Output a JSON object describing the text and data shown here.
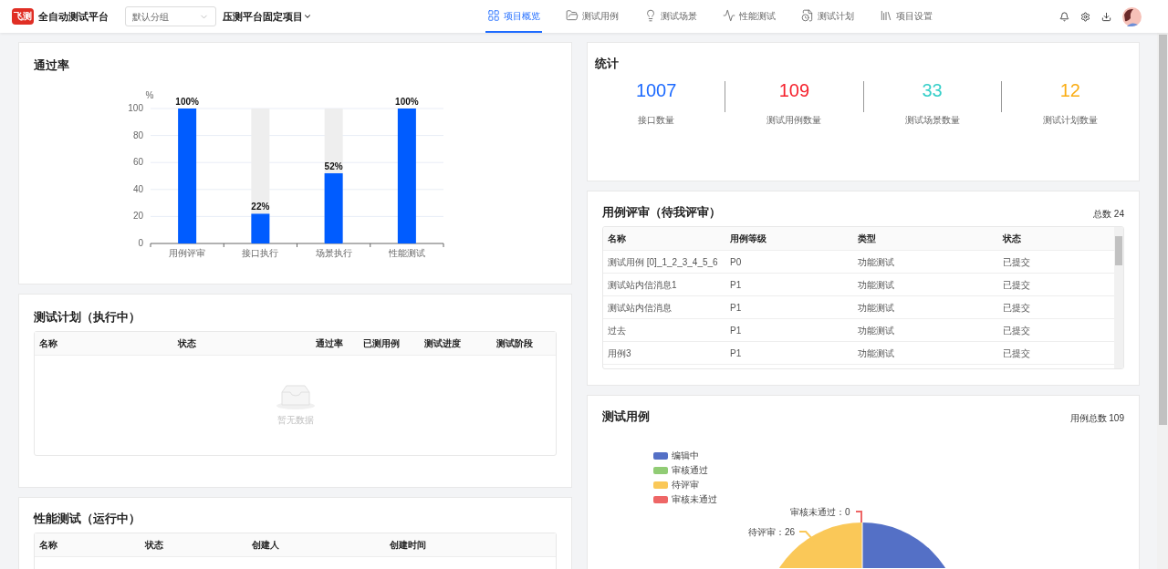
{
  "header": {
    "logo_text": "飞测",
    "app_name": "全自动测试平台",
    "group_select": {
      "value": "默认分组"
    },
    "project": "压测平台固定项目",
    "nav": [
      {
        "label": "项目概览",
        "selected": true
      },
      {
        "label": "测试用例",
        "selected": false
      },
      {
        "label": "测试场景",
        "selected": false
      },
      {
        "label": "性能测试",
        "selected": false
      },
      {
        "label": "测试计划",
        "selected": false
      },
      {
        "label": "项目设置",
        "selected": false
      }
    ]
  },
  "pass_rate": {
    "title": "通过率",
    "chart_data": {
      "type": "bar",
      "ylabel": "%",
      "categories": [
        "用例评审",
        "接口执行",
        "场景执行",
        "性能测试"
      ],
      "values": [
        100,
        22,
        52,
        100
      ],
      "ylim": [
        0,
        100
      ],
      "grid": true,
      "yticks": [
        0,
        20,
        40,
        60,
        80,
        100
      ],
      "value_labels": [
        "100%",
        "22%",
        "52%",
        "100%"
      ]
    }
  },
  "test_plans": {
    "title": "测试计划（执行中）",
    "columns": [
      "名称",
      "状态",
      "通过率",
      "已测用例",
      "测试进度",
      "测试阶段"
    ],
    "empty_text": "暂无数据"
  },
  "perf_tests": {
    "title": "性能测试（运行中）",
    "columns": [
      "名称",
      "状态",
      "创建人",
      "创建时间"
    ]
  },
  "stats": {
    "title": "统计",
    "items": [
      {
        "value": "1007",
        "label": "接口数量",
        "color": "#1e6bff"
      },
      {
        "value": "109",
        "label": "测试用例数量",
        "color": "#f5222d"
      },
      {
        "value": "33",
        "label": "测试场景数量",
        "color": "#36cfc9"
      },
      {
        "value": "12",
        "label": "测试计划数量",
        "color": "#faad14"
      }
    ]
  },
  "review": {
    "title": "用例评审（待我评审）",
    "total": "总数 24",
    "columns": [
      "名称",
      "用例等级",
      "类型",
      "状态"
    ],
    "rows": [
      [
        "测试用例 [0]_1_2_3_4_5_6",
        "P0",
        "功能测试",
        "已提交"
      ],
      [
        "测试站内信消息1",
        "P1",
        "功能测试",
        "已提交"
      ],
      [
        "测试站内信消息",
        "P1",
        "功能测试",
        "已提交"
      ],
      [
        "过去",
        "P1",
        "功能测试",
        "已提交"
      ],
      [
        "用例3",
        "P1",
        "功能测试",
        "已提交"
      ]
    ]
  },
  "test_cases": {
    "title": "测试用例",
    "total": "用例总数 109",
    "legend": [
      {
        "label": "编辑中",
        "color": "#5470c6"
      },
      {
        "label": "审核通过",
        "color": "#91cc75"
      },
      {
        "label": "待评审",
        "color": "#fac858"
      },
      {
        "label": "审核未通过",
        "color": "#ee6666"
      }
    ],
    "slice_labels": [
      {
        "text": "审核未通过：0",
        "color": "#ee6666"
      },
      {
        "text": "待评审：26",
        "color": "#fac858"
      }
    ]
  }
}
